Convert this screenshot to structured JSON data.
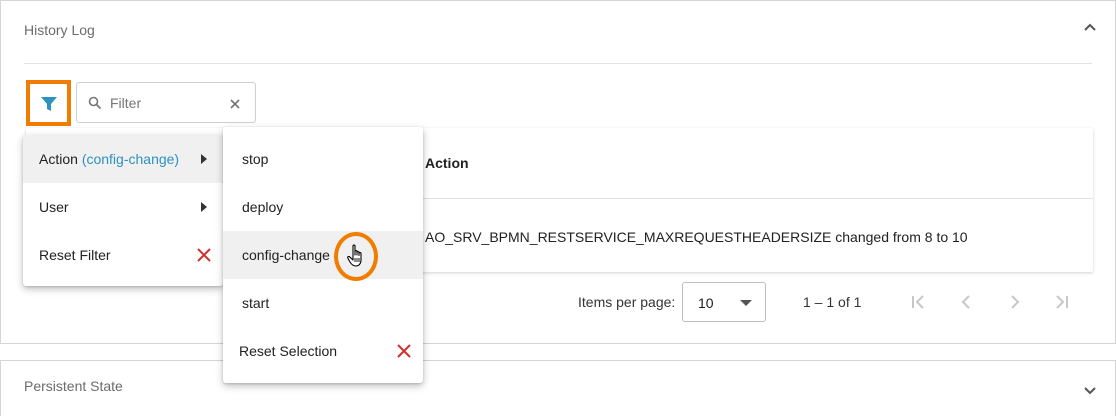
{
  "history_panel": {
    "title": "History Log"
  },
  "filter": {
    "placeholder": "Filter",
    "value": ""
  },
  "table": {
    "column_action": "Action",
    "rows": [
      {
        "action": "AO_SRV_BPMN_RESTSERVICE_MAXREQUESTHEADERSIZE changed from 8 to 10"
      }
    ]
  },
  "paginator": {
    "items_per_page_label": "Items per page:",
    "page_size": "10",
    "range": "1 – 1 of 1"
  },
  "filter_menu": {
    "items": [
      {
        "label": "Action",
        "selection": "(config-change)"
      },
      {
        "label": "User"
      },
      {
        "label": "Reset Filter"
      }
    ]
  },
  "action_submenu": {
    "items": [
      {
        "label": "stop"
      },
      {
        "label": "deploy"
      },
      {
        "label": "config-change"
      },
      {
        "label": "start"
      },
      {
        "label": "Reset Selection"
      }
    ]
  },
  "persistent_panel": {
    "title": "Persistent State"
  },
  "colors": {
    "highlight": "#f07d00",
    "accent": "#2d91c2",
    "reset_x": "#d32f2f"
  },
  "icons": [
    "chevron-up-icon",
    "filter-icon",
    "search-icon",
    "clear-icon",
    "chevron-right-icon",
    "close-icon",
    "first-page-icon",
    "prev-page-icon",
    "next-page-icon",
    "last-page-icon",
    "chevron-down-icon",
    "hand-cursor-icon"
  ]
}
